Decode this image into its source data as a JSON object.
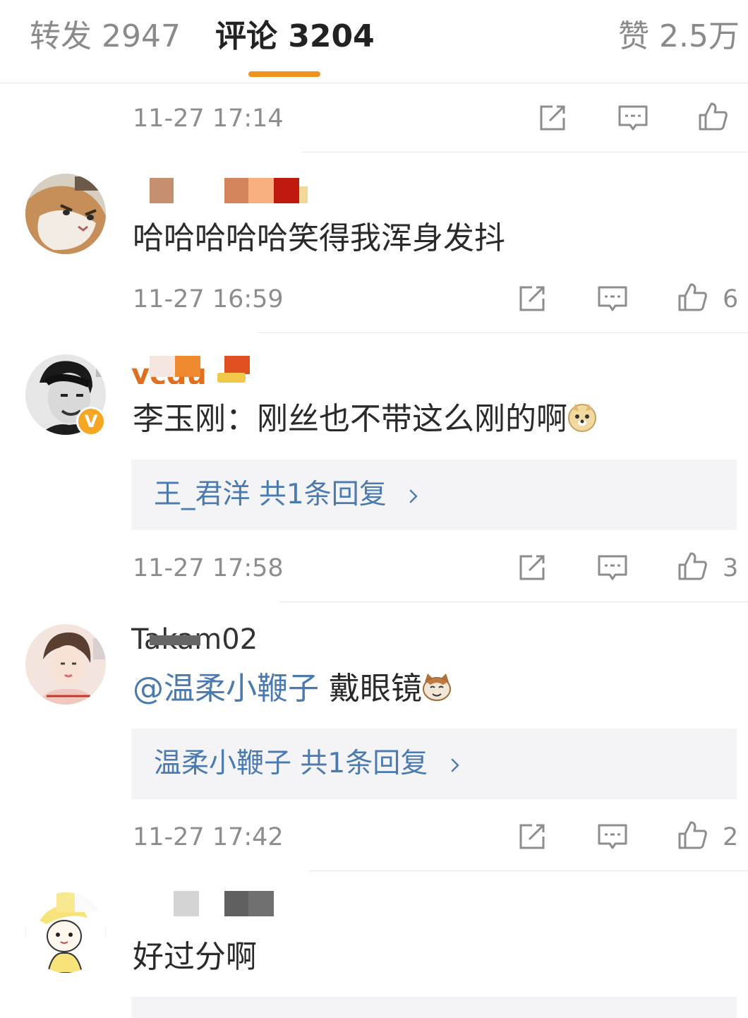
{
  "tabs": {
    "repost": "转发 2947",
    "comments": "评论 3204",
    "likes": "赞 2.5万"
  },
  "top_item": {
    "time": "11-27 17:14"
  },
  "comments": [
    {
      "text": "哈哈哈哈哈笑得我浑身发抖",
      "time": "11-27 16:59",
      "likes": "6"
    },
    {
      "name_fragment": "ycdu",
      "text": "李玉刚：刚丝也不带这么刚的啊",
      "reply": "王_君洋  共1条回复",
      "time": "11-27 17:58",
      "likes": "3"
    },
    {
      "name_fragment": "Takam02",
      "mention": "@温柔小鞭子",
      "text": " 戴眼镜",
      "reply": "温柔小鞭子  共1条回复",
      "time": "11-27 17:42",
      "likes": "2"
    },
    {
      "text": "好过分啊"
    }
  ],
  "icons": {
    "repost": "share-edit-icon",
    "comment": "comment-bubble-icon",
    "like": "thumbs-up-icon",
    "chevron": "chevron-right-icon",
    "verified": "verified-v-badge"
  },
  "colors": {
    "accent": "#f0941e",
    "link": "#4a7ab0",
    "muted": "#8d8d8d",
    "reply_bg": "#f4f4f6"
  }
}
